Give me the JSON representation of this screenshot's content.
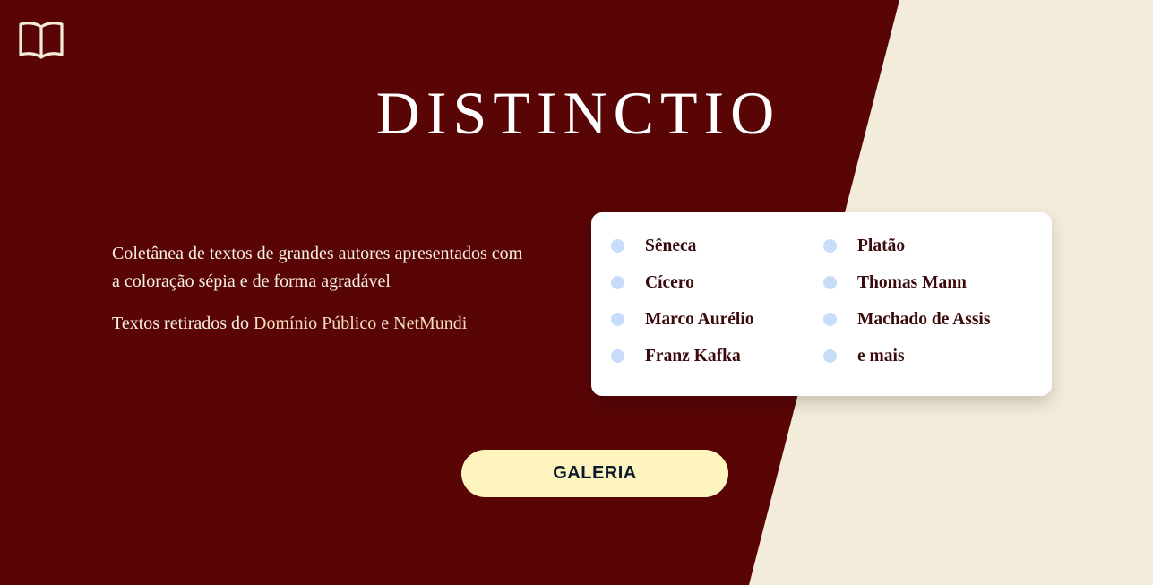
{
  "colors": {
    "primary_bg": "#590506",
    "secondary_bg": "#F3ECDB",
    "card_bg": "#FFFFFF",
    "bullet": "#C8DDFA",
    "author_text": "#3A0A0C",
    "button_bg": "#FEF5BE",
    "button_text": "#0D1A2E"
  },
  "header": {
    "logo_icon": "open-book-icon",
    "title": "DISTINCTIO"
  },
  "intro": {
    "description": "Coletânea de textos de grandes autores apresentados com a coloração sépia e de forma agradável",
    "source_prefix": "Textos retirados do ",
    "source_link_1": "Domínio Público",
    "source_connector": " e ",
    "source_link_2": "NetMundi"
  },
  "authors": [
    "Sêneca",
    "Cícero",
    "Marco Aurélio",
    "Franz Kafka",
    "Platão",
    "Thomas Mann",
    "Machado de Assis",
    "e mais"
  ],
  "cta": {
    "label": "GALERIA"
  }
}
